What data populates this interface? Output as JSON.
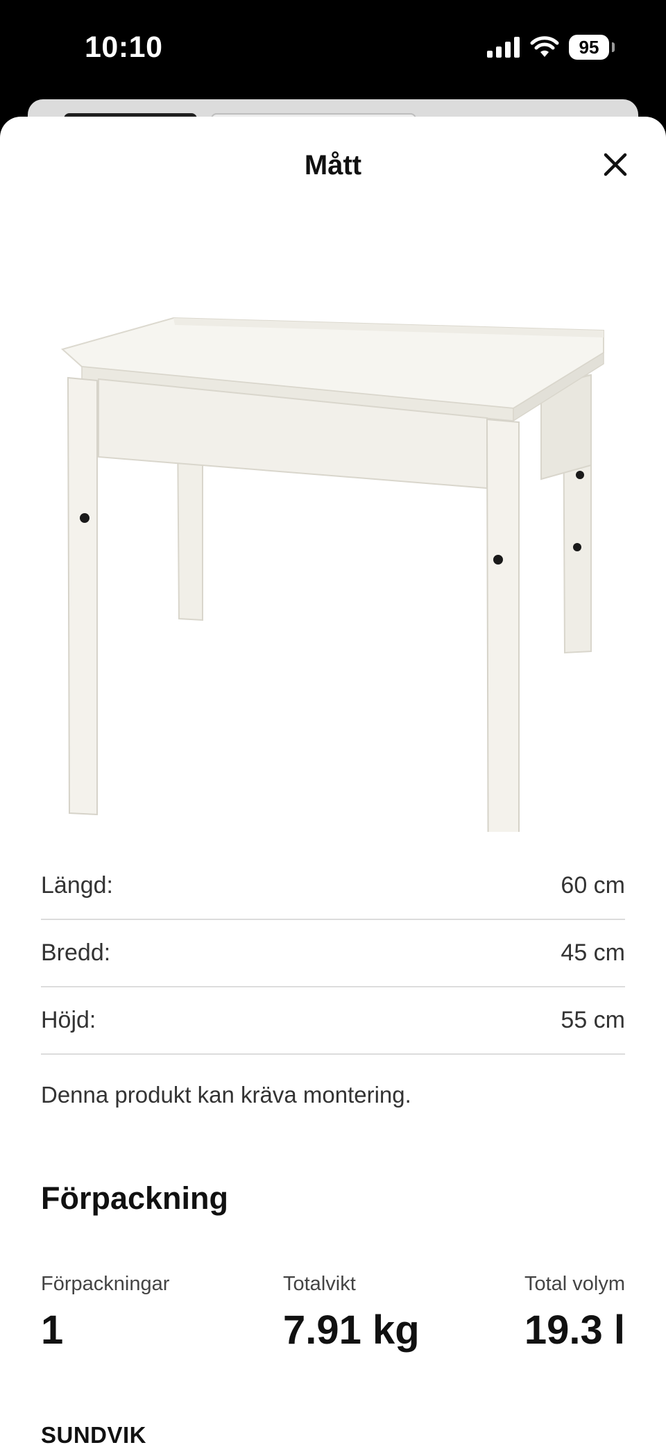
{
  "status_bar": {
    "time": "10:10",
    "battery": "95",
    "icons": [
      "cellular-signal-icon",
      "wifi-icon",
      "battery-icon"
    ]
  },
  "sheet": {
    "title": "Mått",
    "close_icon": "close-icon"
  },
  "product": {
    "image": "white-children-desk-image"
  },
  "dimensions": [
    {
      "label": "Längd:",
      "value": "60 cm"
    },
    {
      "label": "Bredd:",
      "value": "45 cm"
    },
    {
      "label": "Höjd:",
      "value": "55 cm"
    }
  ],
  "assembly_note": "Denna produkt kan kräva montering.",
  "packaging": {
    "title": "Förpackning",
    "stats": [
      {
        "label": "Förpackningar",
        "value": "1"
      },
      {
        "label": "Totalvikt",
        "value": "7.91 kg"
      },
      {
        "label": "Total volym",
        "value": "19.3 l"
      }
    ],
    "product_name": "SUNDVIK"
  },
  "colors": {
    "background": "#ffffff",
    "text": "#111111",
    "divider": "#dcdcdc",
    "status_bar": "#000000"
  }
}
